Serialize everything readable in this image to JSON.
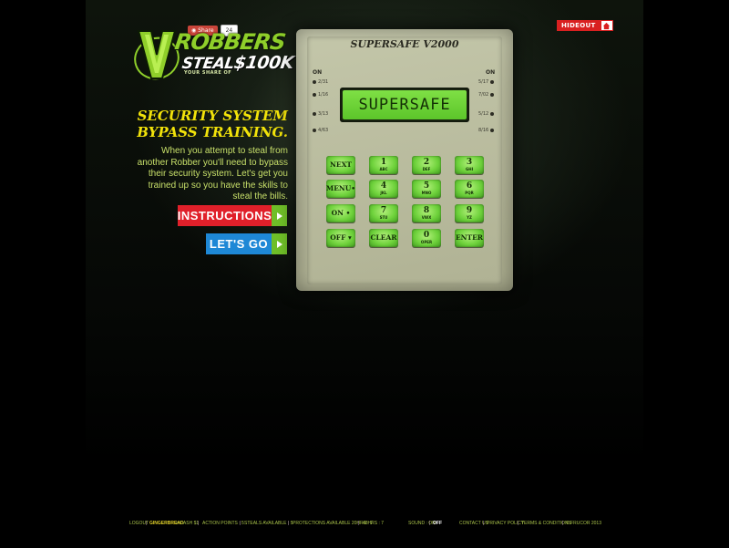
{
  "share": {
    "label": "Share",
    "count": "24"
  },
  "hideout": {
    "label": "HIDEOUT",
    "icon": "house-icon"
  },
  "logo": {
    "word": "ROBBERS",
    "steal": "STEAL",
    "amount": "$100K",
    "sub": "YOUR SHARE OF"
  },
  "headline": {
    "line1": "SECURITY SYSTEM",
    "line2": "BYPASS TRAINING."
  },
  "body_copy": "When you attempt to steal from another Robber you'll need to bypass their security system. Let's get you trained up so you have the skills to steal the bills.",
  "buttons": {
    "instructions": "INSTRUCTIONS",
    "lets_go": "LET'S GO"
  },
  "device": {
    "title": "SUPERSAFE V2000",
    "lcd": "SUPERSAFE",
    "on_left": "ON",
    "on_right": "ON",
    "slots_left": [
      "2/31",
      "1/16",
      "3/13",
      "4/63"
    ],
    "slots_right": [
      "5/17",
      "7/02",
      "5/12",
      "8/16"
    ],
    "keys": {
      "next": "NEXT",
      "menu": "MENU•",
      "on": "ON •",
      "off": "OFF ▾",
      "clear": "CLEAR",
      "enter": "ENTER",
      "k1": "1",
      "k1s": "ABC",
      "k2": "2",
      "k2s": "DEF",
      "k3": "3",
      "k3s": "GHI",
      "k4": "4",
      "k4s": "JKL",
      "k5": "5",
      "k5s": "MNO",
      "k6": "6",
      "k6s": "PQR",
      "k7": "7",
      "k7s": "STU",
      "k8": "8",
      "k8s": "VWX",
      "k9": "9",
      "k9s": "YZ",
      "k0": "0",
      "k0s": "OPER"
    }
  },
  "footer": {
    "logout": "LOGOUT",
    "user": "GINGERBREAD",
    "cash": "> CASH $1",
    "action_points": "ACTION POINTS : 5",
    "steals": "STEALS AVAILABLE : 5",
    "protections": "PROTECTIONS AVAILABLE 20HRS : 7",
    "hours": "48HRS : 7",
    "sound_label": "SOUND : ON",
    "sound_off": "OFF",
    "contact": "CONTACT US",
    "privacy": "PRIVACY POLICY",
    "terms": "TERMS & CONDITIONS",
    "copyright": "© FRUCOR 2013"
  },
  "colors": {
    "accent_green": "#8fcf2a",
    "headline_yellow": "#f2e30a",
    "instructions_red": "#e0202a",
    "letsgo_blue": "#1e88d6",
    "key_green": "#6fd23c"
  }
}
